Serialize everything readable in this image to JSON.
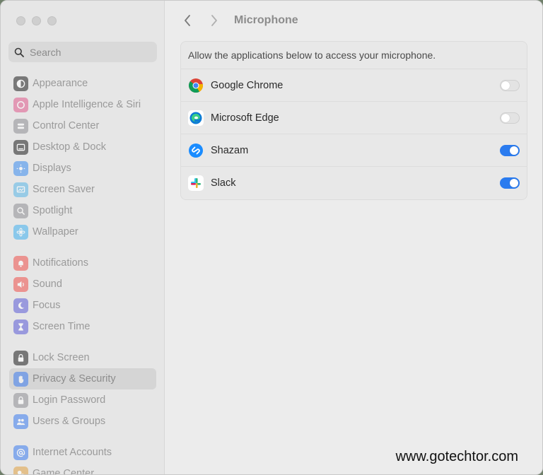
{
  "search": {
    "placeholder": "Search"
  },
  "sidebar": {
    "groups": [
      [
        {
          "label": "Appearance",
          "icon": "appearance-icon",
          "color": "#1e1e1e"
        },
        {
          "label": "Apple Intelligence & Siri",
          "icon": "siri-icon",
          "color": "#e05a8c"
        },
        {
          "label": "Control Center",
          "icon": "control-center-icon",
          "color": "#8e8e93"
        },
        {
          "label": "Desktop & Dock",
          "icon": "dock-icon",
          "color": "#1e1e1e"
        },
        {
          "label": "Displays",
          "icon": "sun-icon",
          "color": "#3b8df0"
        },
        {
          "label": "Screen Saver",
          "icon": "screen-saver-icon",
          "color": "#5ab6e6"
        },
        {
          "label": "Spotlight",
          "icon": "spotlight-icon",
          "color": "#8e8e93"
        },
        {
          "label": "Wallpaper",
          "icon": "wallpaper-icon",
          "color": "#3fb0f0"
        }
      ],
      [
        {
          "label": "Notifications",
          "icon": "bell-icon",
          "color": "#f0504a"
        },
        {
          "label": "Sound",
          "icon": "speaker-icon",
          "color": "#f0504a"
        },
        {
          "label": "Focus",
          "icon": "moon-icon",
          "color": "#5b5bd6"
        },
        {
          "label": "Screen Time",
          "icon": "hourglass-icon",
          "color": "#5b5bd6"
        }
      ],
      [
        {
          "label": "Lock Screen",
          "icon": "lock-icon",
          "color": "#1e1e1e"
        },
        {
          "label": "Privacy & Security",
          "icon": "hand-icon",
          "color": "#3b7cf0",
          "active": true
        },
        {
          "label": "Login Password",
          "icon": "padlock-icon",
          "color": "#8e8e93"
        },
        {
          "label": "Users & Groups",
          "icon": "users-icon",
          "color": "#3b7cf0"
        }
      ],
      [
        {
          "label": "Internet Accounts",
          "icon": "at-icon",
          "color": "#3b7cf0"
        },
        {
          "label": "Game Center",
          "icon": "game-center-icon",
          "color": "#e0a040"
        }
      ]
    ]
  },
  "main": {
    "title": "Microphone",
    "description": "Allow the applications below to access your microphone.",
    "apps": [
      {
        "name": "Google Chrome",
        "icon": "chrome-icon",
        "enabled": false
      },
      {
        "name": "Microsoft Edge",
        "icon": "edge-icon",
        "enabled": false
      },
      {
        "name": "Shazam",
        "icon": "shazam-icon",
        "enabled": true
      },
      {
        "name": "Slack",
        "icon": "slack-icon",
        "enabled": true
      }
    ]
  },
  "watermark": "www.gotechtor.com",
  "colors": {
    "accent": "#2a7bef"
  }
}
